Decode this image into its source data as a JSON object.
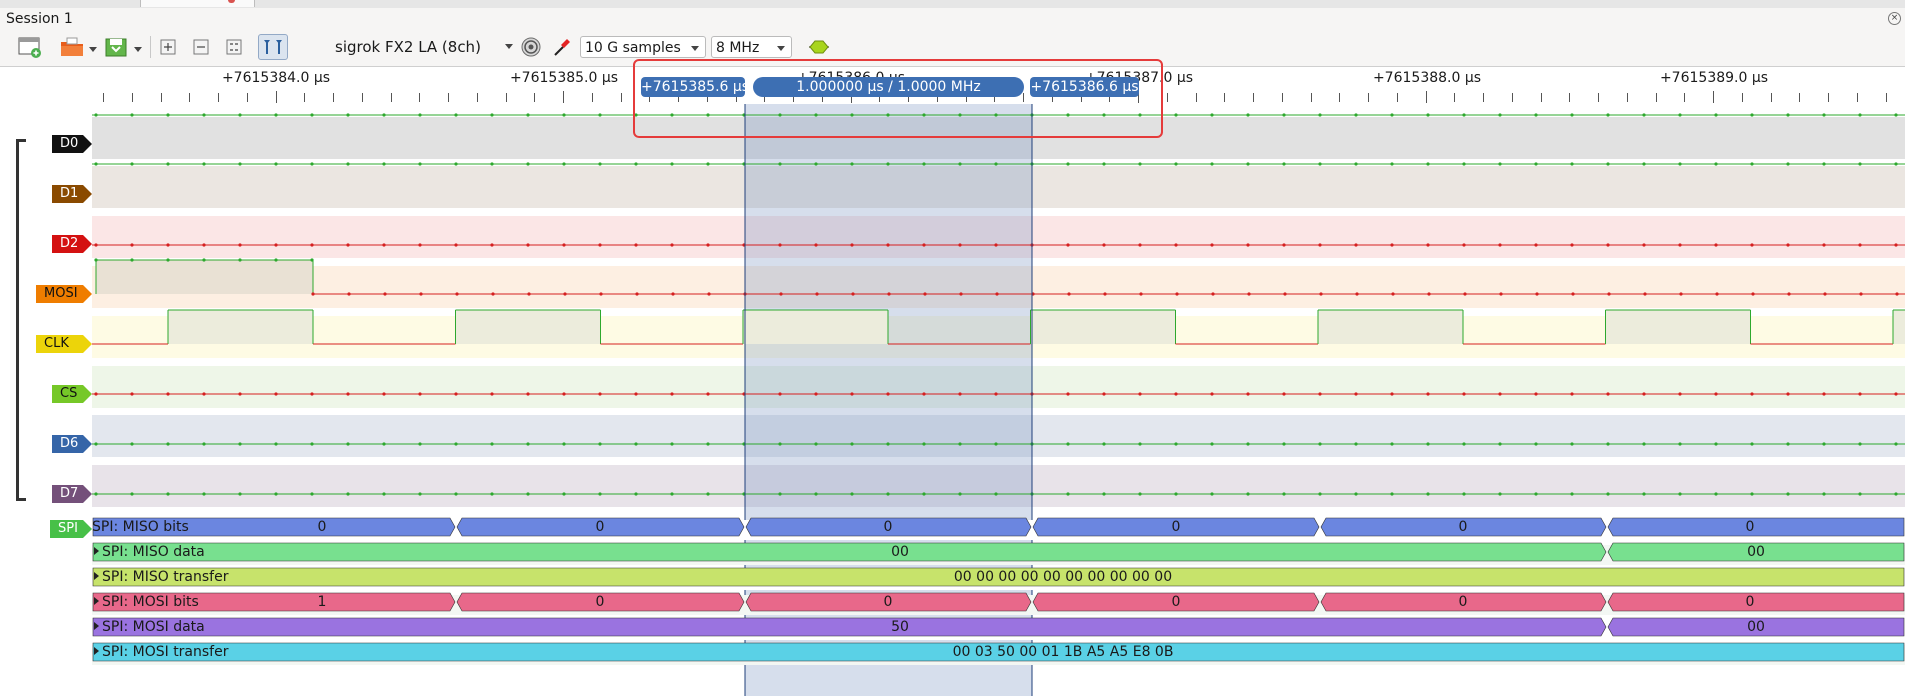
{
  "session": {
    "title": "Session 1"
  },
  "toolbar": {
    "device": "sigrok FX2 LA (8ch)",
    "samples": "10 G samples",
    "samplerate": "8 MHz"
  },
  "ruler": {
    "labels": [
      "+7615384.0 μs",
      "+7615385.0 μs",
      "+7615386.0 μs",
      "+7615387.0 μs",
      "+7615388.0 μs",
      "+7615389.0 μs"
    ]
  },
  "cursors": {
    "left": "+7615385.6 μs",
    "right": "+7615386.6 μs",
    "interval": "1.000000 μs / 1.0000 MHz"
  },
  "channels": [
    {
      "name": "D0",
      "color": "#111111",
      "text_color": "#ffffff",
      "bg": "#e1e1e1"
    },
    {
      "name": "D1",
      "color": "#8a4a00",
      "text_color": "#ffffff",
      "bg": "#ebe6e1"
    },
    {
      "name": "D2",
      "color": "#d41111",
      "text_color": "#ffffff",
      "bg": "#fbe6e6"
    },
    {
      "name": "MOSI",
      "color": "#ef7d00",
      "text_color": "#111111",
      "bg": "#fdefe2"
    },
    {
      "name": "CLK",
      "color": "#ecd40a",
      "text_color": "#111111",
      "bg": "#fefbe4"
    },
    {
      "name": "CS",
      "color": "#76c828",
      "text_color": "#111111",
      "bg": "#eef6e8"
    },
    {
      "name": "D6",
      "color": "#3565a8",
      "text_color": "#ffffff",
      "bg": "#e3e7ee"
    },
    {
      "name": "D7",
      "color": "#74507a",
      "text_color": "#ffffff",
      "bg": "#e8e3e9"
    }
  ],
  "decoder": {
    "badge": "SPI",
    "badge_color": "#47c048",
    "rows": [
      {
        "name": "SPI: MISO bits",
        "color": "#6b86e0",
        "labels": [
          "0",
          "0",
          "0",
          "0",
          "0",
          "0"
        ]
      },
      {
        "name": "SPI: MISO data",
        "color": "#78e08f",
        "labels": [
          "00",
          "00"
        ]
      },
      {
        "name": "SPI: MISO transfer",
        "color": "#c7e36b",
        "labels": [
          "00 00 00 00 00 00 00 00 00 00"
        ]
      },
      {
        "name": "SPI: MOSI bits",
        "color": "#e8688a",
        "labels": [
          "1",
          "0",
          "0",
          "0",
          "0",
          "0"
        ]
      },
      {
        "name": "SPI: MOSI data",
        "color": "#9a73e0",
        "labels": [
          "50",
          "00"
        ]
      },
      {
        "name": "SPI: MOSI transfer",
        "color": "#5ad1e6",
        "labels": [
          "00 03 50 00 01 1B A5 A5 E8 0B"
        ]
      }
    ]
  }
}
